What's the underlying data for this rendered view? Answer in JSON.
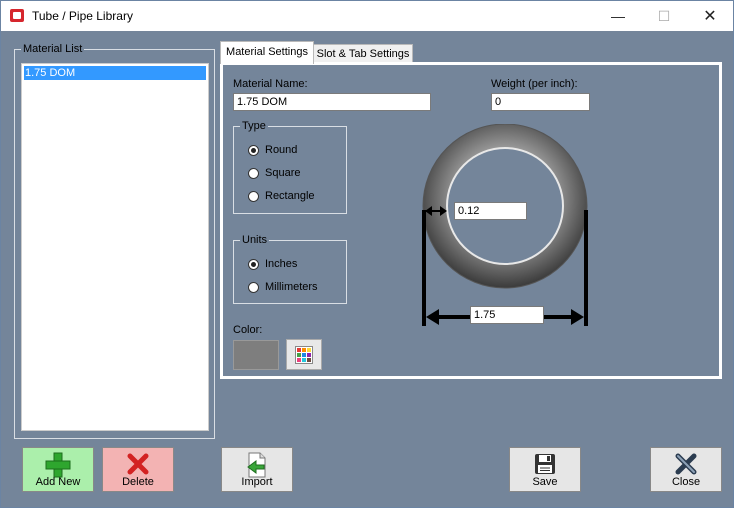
{
  "window": {
    "title": "Tube / Pipe  Library",
    "controls": {
      "minimize": "—",
      "maximize": "☐",
      "close": "✕"
    }
  },
  "material_list": {
    "title": "Material List",
    "items": [
      "1.75 DOM"
    ],
    "selected_index": 0
  },
  "tabs": [
    {
      "label": "Material Settings",
      "active": true
    },
    {
      "label": "Slot & Tab Settings",
      "active": false
    }
  ],
  "material_settings": {
    "name_label": "Material Name:",
    "name_value": "1.75 DOM",
    "weight_label": "Weight (per inch):",
    "weight_value": "0",
    "type": {
      "title": "Type",
      "options": [
        "Round",
        "Square",
        "Rectangle"
      ],
      "selected": "Round"
    },
    "units": {
      "title": "Units",
      "options": [
        "Inches",
        "Millimeters"
      ],
      "selected": "Inches"
    },
    "color_label": "Color:",
    "color_value": "#7e7e7e",
    "color_picker_icon": "color-palette-icon",
    "diagram": {
      "wall_thickness": "0.12",
      "outer_diameter": "1.75"
    }
  },
  "buttons": {
    "add_new": {
      "label": "Add New",
      "icon": "plus-icon",
      "color": "#abefab"
    },
    "delete": {
      "label": "Delete",
      "icon": "x-icon",
      "color": "#f3b3b3"
    },
    "import": {
      "label": "Import",
      "icon": "import-icon"
    },
    "save": {
      "label": "Save",
      "icon": "floppy-disk-icon"
    },
    "close": {
      "label": "Close",
      "icon": "close-x-icon"
    }
  }
}
